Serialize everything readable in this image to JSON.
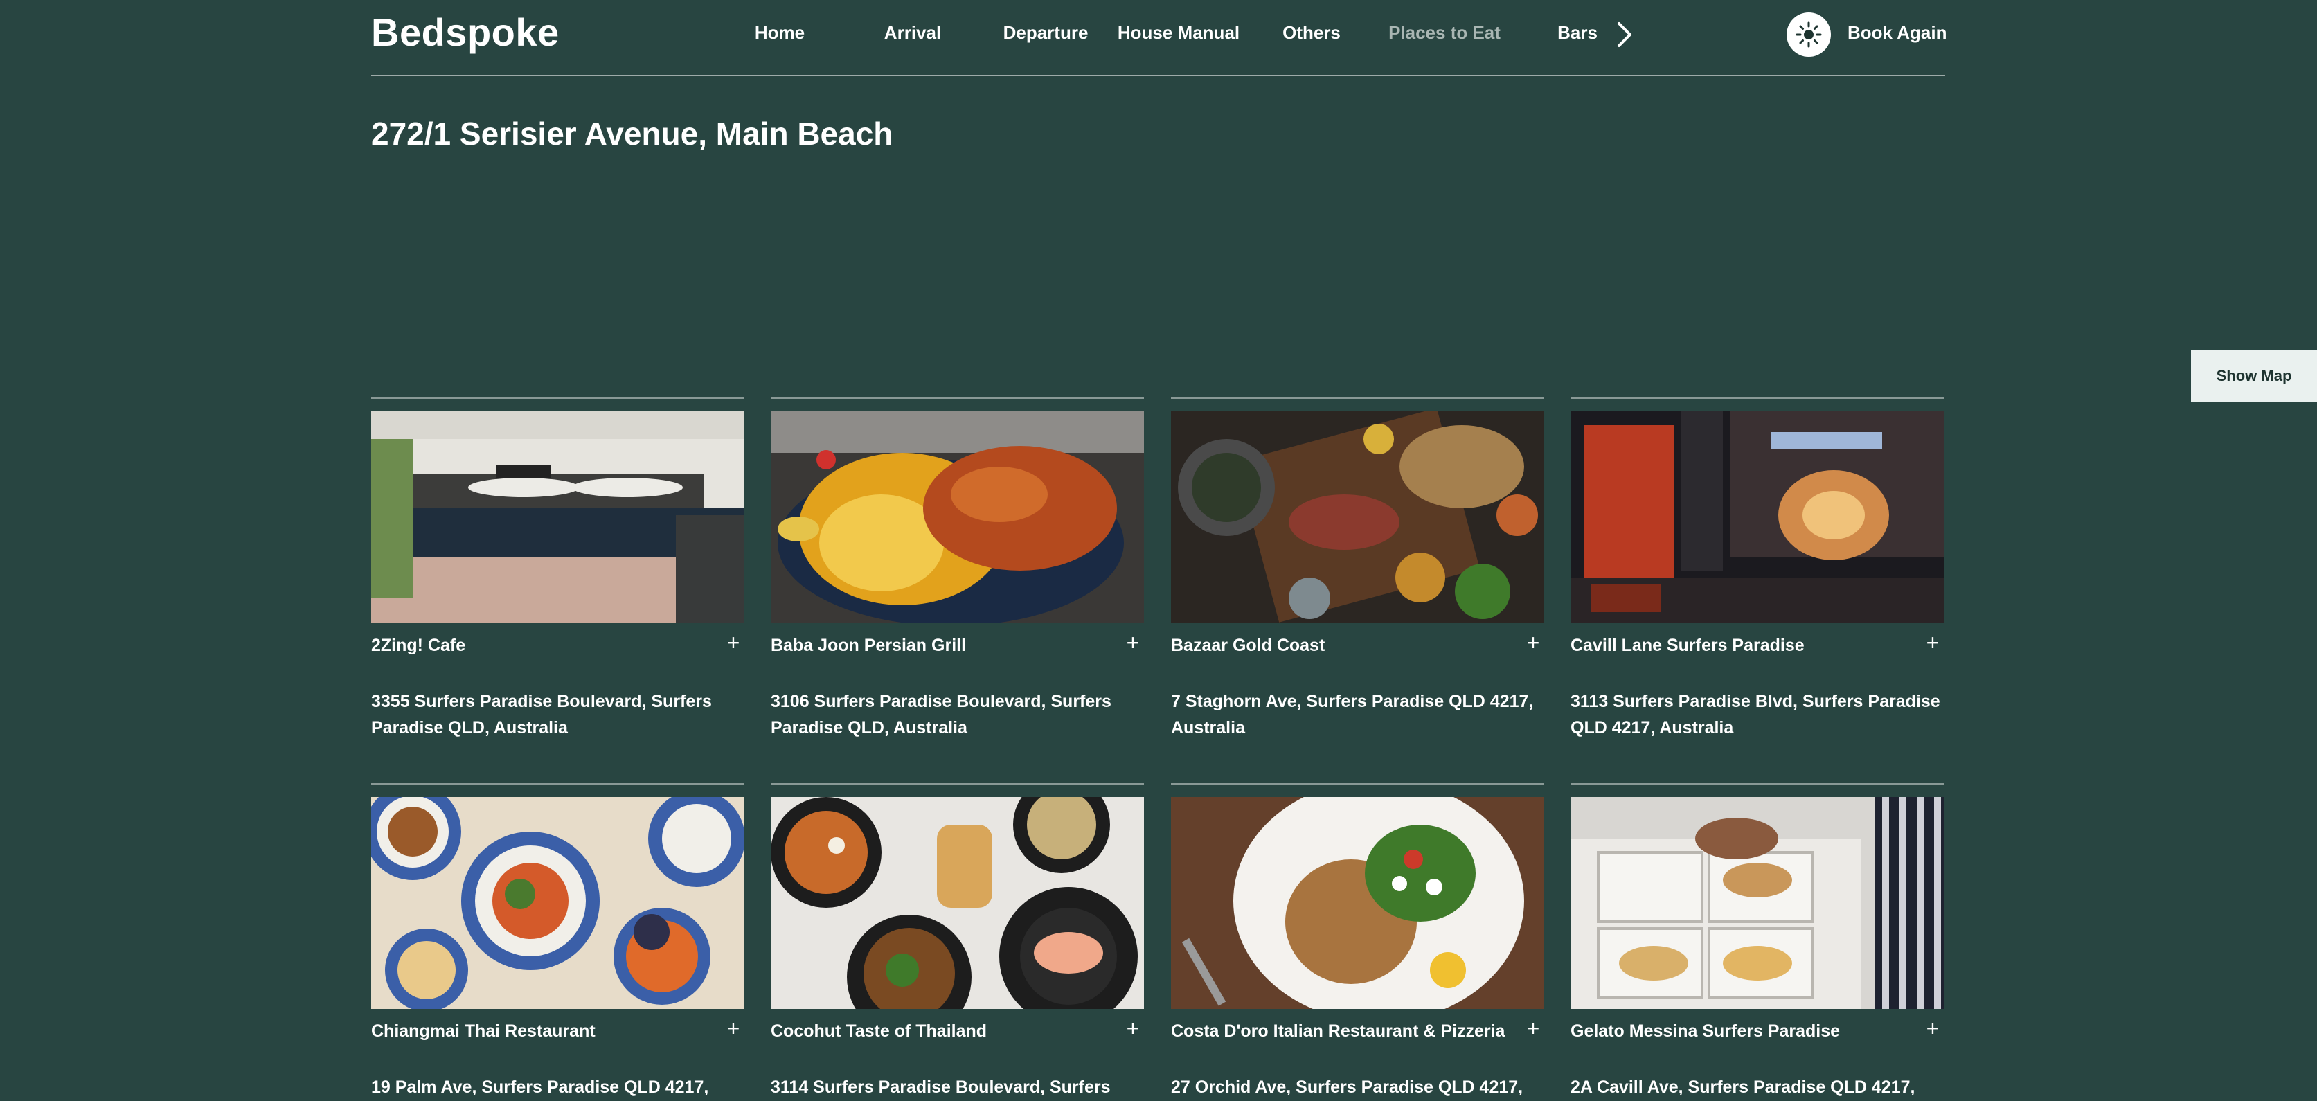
{
  "header": {
    "logo": "Bedspoke",
    "nav": [
      {
        "label": "Home"
      },
      {
        "label": "Arrival"
      },
      {
        "label": "Departure"
      },
      {
        "label": "House Manual"
      },
      {
        "label": "Others"
      },
      {
        "label": "Places to Eat",
        "active": true
      },
      {
        "label": "Bars"
      }
    ],
    "book_again": "Book Again",
    "icons": {
      "nav_next": "chevron-right-icon",
      "theme": "sun-icon"
    }
  },
  "page_title": "272/1 Serisier Avenue, Main Beach",
  "show_map": "Show Map",
  "places": [
    {
      "name": "2Zing! Cafe",
      "address": "3355 Surfers Paradise Boulevard, Surfers Paradise QLD, Australia",
      "icon": "plus-icon"
    },
    {
      "name": "Baba Joon Persian Grill",
      "address": "3106 Surfers Paradise Boulevard, Surfers Paradise QLD, Australia",
      "icon": "plus-icon"
    },
    {
      "name": "Bazaar Gold Coast",
      "address": "7 Staghorn Ave, Surfers Paradise QLD 4217, Australia",
      "icon": "plus-icon"
    },
    {
      "name": "Cavill Lane Surfers Paradise",
      "address": "3113 Surfers Paradise Blvd, Surfers Paradise QLD 4217, Australia",
      "icon": "plus-icon"
    },
    {
      "name": "Chiangmai Thai Restaurant",
      "address": "19 Palm Ave, Surfers Paradise QLD 4217,",
      "icon": "plus-icon"
    },
    {
      "name": "Cocohut Taste of Thailand",
      "address": "3114 Surfers Paradise Boulevard, Surfers",
      "icon": "plus-icon"
    },
    {
      "name": "Costa D'oro Italian Restaurant & Pizzeria",
      "address": "27 Orchid Ave, Surfers Paradise QLD 4217,",
      "icon": "plus-icon"
    },
    {
      "name": "Gelato Messina Surfers Paradise",
      "address": "2A Cavill Ave, Surfers Paradise QLD 4217,",
      "icon": "plus-icon"
    }
  ],
  "colors": {
    "background": "#284541",
    "text": "#ffffff",
    "nav_dim": "#a9b6b3",
    "map_button": "#eaf1ef"
  }
}
